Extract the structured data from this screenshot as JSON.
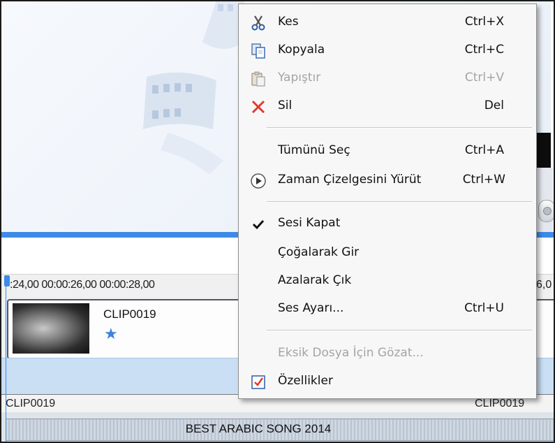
{
  "context_menu": {
    "items": [
      {
        "label": "Kes",
        "shortcut": "Ctrl+X",
        "icon": "scissors-icon",
        "enabled": true
      },
      {
        "label": "Kopyala",
        "shortcut": "Ctrl+C",
        "icon": "copy-icon",
        "enabled": true
      },
      {
        "label": "Yapıştır",
        "shortcut": "Ctrl+V",
        "icon": "paste-icon",
        "enabled": false
      },
      {
        "label": "Sil",
        "shortcut": "Del",
        "icon": "delete-x-icon",
        "enabled": true
      },
      {
        "label": "Tümünü Seç",
        "shortcut": "Ctrl+A",
        "enabled": true
      },
      {
        "label": "Zaman Çizelgesini Yürüt",
        "shortcut": "Ctrl+W",
        "icon": "play-circle-icon",
        "enabled": true
      },
      {
        "label": "Sesi Kapat",
        "checked": true,
        "icon": "checkmark-icon",
        "enabled": true
      },
      {
        "label": "Çoğalarak Gir",
        "enabled": true
      },
      {
        "label": "Azalarak Çık",
        "enabled": true
      },
      {
        "label": "Ses Ayarı...",
        "shortcut": "Ctrl+U",
        "enabled": true
      },
      {
        "label": "Eksik Dosya İçin Gözat...",
        "enabled": false
      },
      {
        "label": "Özellikler",
        "icon": "properties-icon",
        "enabled": true
      }
    ]
  },
  "timeline": {
    "ruler_text": ":24,00  00:00:26,00  00:00:28,00",
    "ruler_right": "6,0",
    "video_clip": {
      "name": "CLIP0019",
      "effect_icon": "star-effect-icon"
    },
    "audio_clip_left": "CLIP0019",
    "audio_clip_right": "CLIP0019",
    "music_title": "BEST ARABIC SONG 2014"
  },
  "colors": {
    "accent_blue": "#3d8be6",
    "delete_red": "#e03a2f",
    "disabled_text": "#a4a4a4",
    "track_light_blue": "#cadff4"
  }
}
